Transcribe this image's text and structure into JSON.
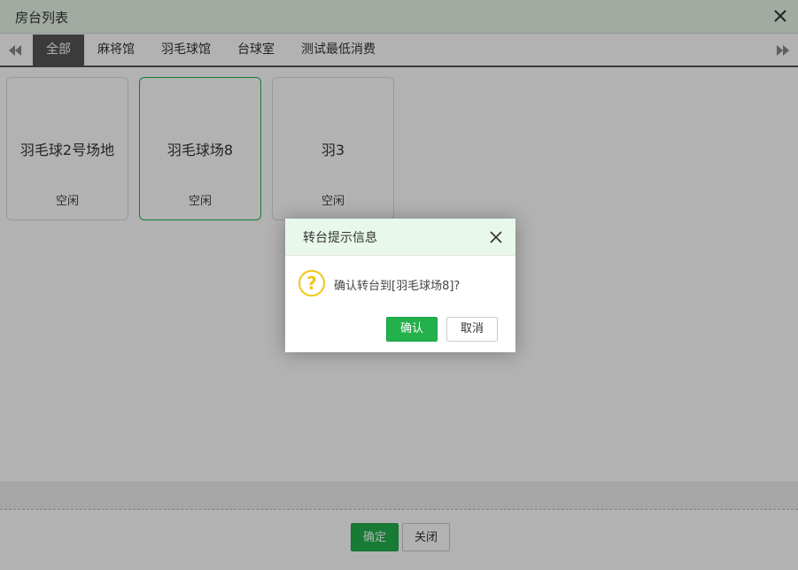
{
  "window": {
    "title": "房台列表"
  },
  "tabs": [
    {
      "label": "全部",
      "active": true
    },
    {
      "label": "麻将馆",
      "active": false
    },
    {
      "label": "羽毛球馆",
      "active": false
    },
    {
      "label": "台球室",
      "active": false
    },
    {
      "label": "测试最低消费",
      "active": false
    }
  ],
  "cards": [
    {
      "name": "羽毛球2号场地",
      "status": "空闲",
      "selected": false
    },
    {
      "name": "羽毛球场8",
      "status": "空闲",
      "selected": true
    },
    {
      "name": "羽3",
      "status": "空闲",
      "selected": false
    }
  ],
  "footer": {
    "confirm_label": "确定",
    "close_label": "关闭"
  },
  "dialog": {
    "title": "转台提示信息",
    "icon": "question-icon",
    "message": "确认转台到[羽毛球场8]?",
    "confirm_label": "确认",
    "cancel_label": "取消"
  },
  "colors": {
    "accent": "#22b14c",
    "active_tab": "#555555",
    "header_bg": "#e8f5e9",
    "warning": "#f0c419"
  }
}
